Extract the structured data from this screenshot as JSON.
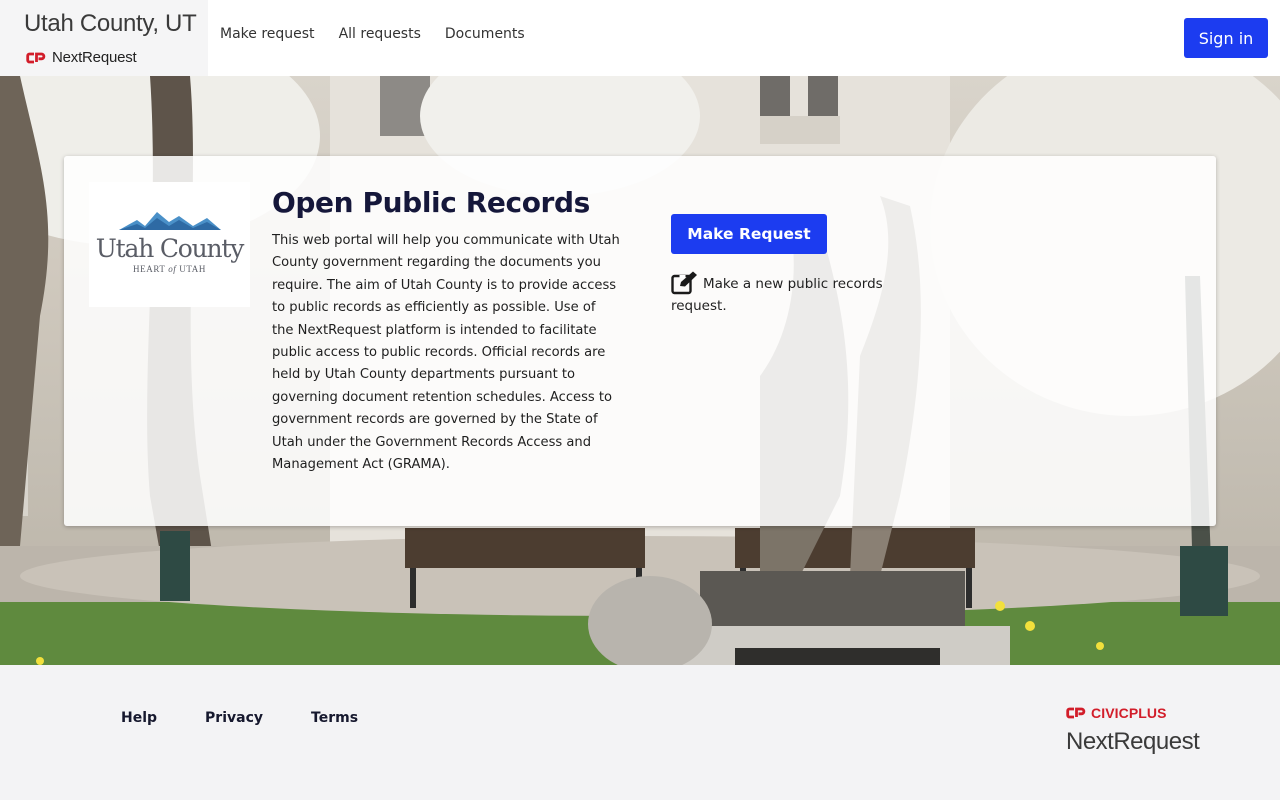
{
  "header": {
    "title": "Utah County, UT",
    "subtitle": "NextRequest",
    "nav": [
      "Make request",
      "All requests",
      "Documents"
    ],
    "signin_label": "Sign in"
  },
  "card": {
    "logo": {
      "name": "Utah County",
      "tagline_pre": "HEART ",
      "tagline_of": "of",
      "tagline_post": " UTAH"
    },
    "title": "Open Public Records",
    "body": "This web portal will help you communicate with Utah County government regarding the documents you require. The aim of Utah County is to provide access to public records as efficiently as possible. Use of the NextRequest platform is intended to facilitate public access to public records. Official records are held by Utah County departments pursuant to governing document retention schedules. Access to government records are governed by the State of Utah under the Government Records Access and Management Act (GRAMA).",
    "make_request_label": "Make Request",
    "make_request_desc": "Make a new public records request."
  },
  "footer": {
    "links": [
      "Help",
      "Privacy",
      "Terms"
    ],
    "civic_a": "CIVIC",
    "civic_b": "PLUS",
    "nextrequest": "NextRequest"
  },
  "colors": {
    "primary": "#1c3cf0",
    "brand_red": "#d21d2a",
    "title": "#15173a",
    "footer_bg": "#f3f3f5"
  },
  "icons": {
    "brand_mark": "civicplus-mark-icon",
    "edit": "edit-square-icon"
  }
}
